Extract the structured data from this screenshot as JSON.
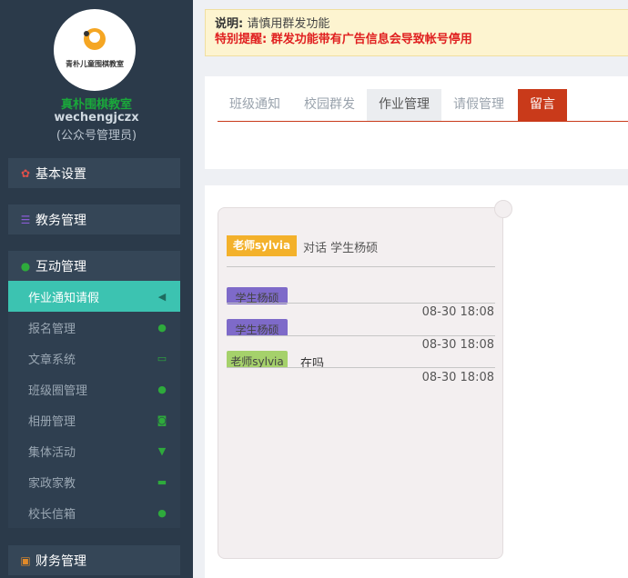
{
  "sidebar": {
    "logo_text": "青朴儿童围棋教室",
    "school_name": "真朴围棋教室",
    "account": "wechengjczx",
    "role": "(公众号管理员)",
    "sections": {
      "basic": "基本设置",
      "academic": "教务管理",
      "interaction": "互动管理",
      "finance": "财务管理"
    },
    "items": [
      {
        "label": "作业通知请假",
        "icon": "megaphone-icon"
      },
      {
        "label": "报名管理",
        "icon": "chat-icon"
      },
      {
        "label": "文章系统",
        "icon": "monitor-icon"
      },
      {
        "label": "班级圈管理",
        "icon": "chat-icon"
      },
      {
        "label": "相册管理",
        "icon": "camera-icon"
      },
      {
        "label": "集体活动",
        "icon": "trophy-icon"
      },
      {
        "label": "家政家教",
        "icon": "coffee-icon"
      },
      {
        "label": "校长信箱",
        "icon": "chat-icon"
      }
    ]
  },
  "notice": {
    "label": "说明:",
    "text": "请慎用群发功能",
    "warning": "特别提醒: 群发功能带有广告信息会导致帐号停用"
  },
  "tabs": [
    "班级通知",
    "校园群发",
    "作业管理",
    "请假管理",
    "留言"
  ],
  "chat": {
    "teacher_tag": "老师sylvia",
    "conversation": "对话 学生杨硕",
    "messages": [
      {
        "sender": "学生杨硕",
        "body": "",
        "time": "08-30 18:08"
      },
      {
        "sender": "学生杨硕",
        "body": "",
        "time": "08-30 18:08"
      },
      {
        "sender": "老师sylvia",
        "body": "在吗",
        "time": "08-30 18:08"
      }
    ]
  },
  "colors": {
    "sidebar_bg": "#2b3a4a",
    "active_item": "#3cc3b1",
    "tab_red": "#c93a1a",
    "teacher_tag": "#f3b12b",
    "student_tag": "#7e6ac9",
    "teacher_msg_tag": "#a5d16b",
    "school_name": "#1aa83b",
    "warning": "#e02020"
  }
}
